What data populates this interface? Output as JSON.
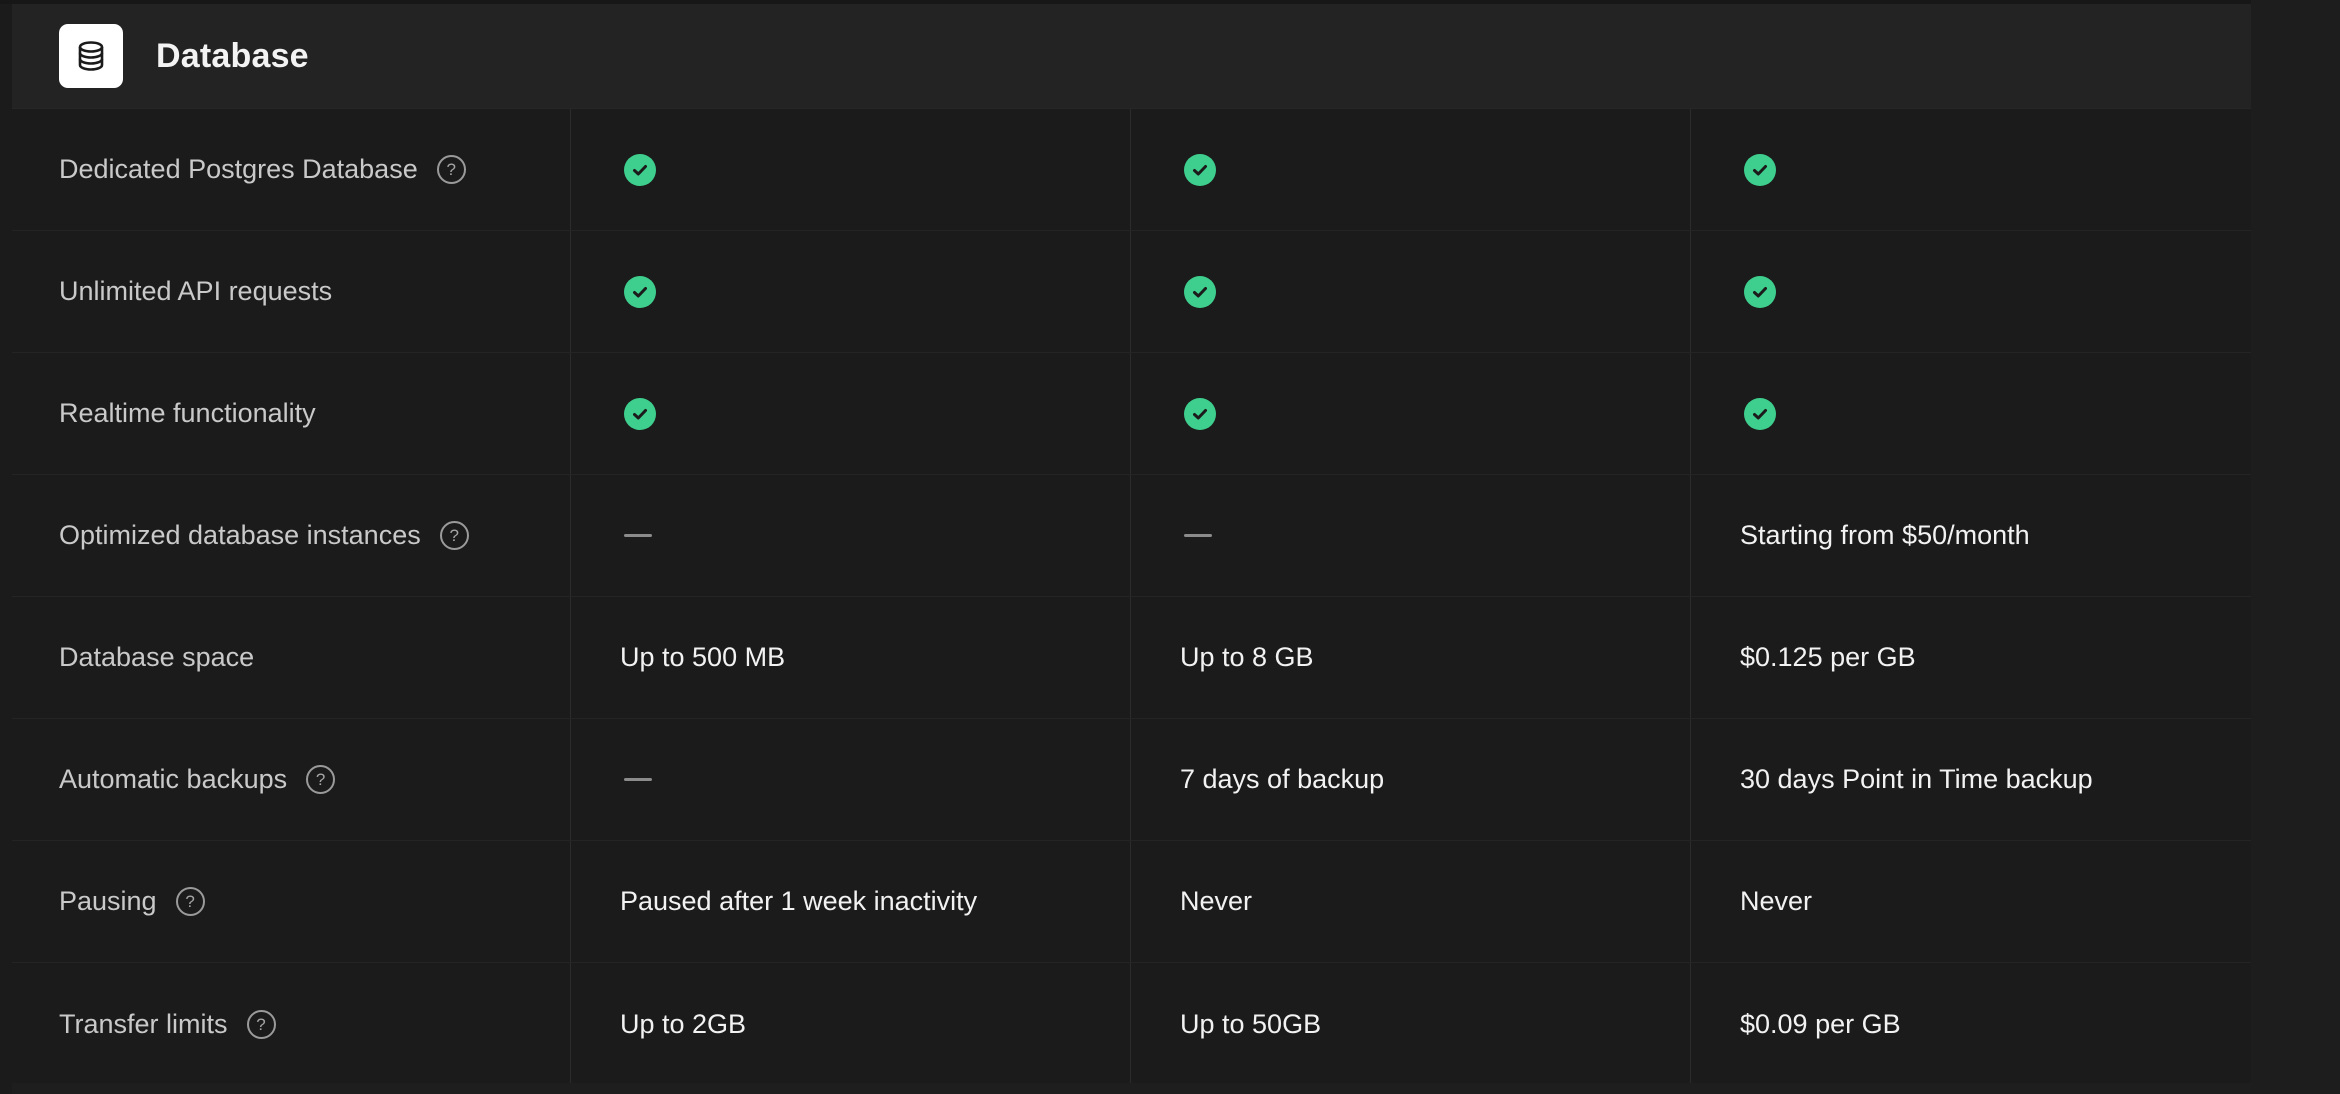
{
  "section": {
    "title": "Database",
    "icon": "database-icon"
  },
  "colors": {
    "check": "#3ecf8e",
    "background": "#1b1b1b",
    "header_background": "#232323"
  },
  "rows": [
    {
      "label": "Dedicated Postgres Database",
      "help": true,
      "cells": [
        {
          "type": "check",
          "icon": "check-circle-icon"
        },
        {
          "type": "check",
          "icon": "check-circle-icon"
        },
        {
          "type": "check",
          "icon": "check-circle-icon"
        }
      ]
    },
    {
      "label": "Unlimited API requests",
      "help": false,
      "cells": [
        {
          "type": "check",
          "icon": "check-circle-icon"
        },
        {
          "type": "check",
          "icon": "check-circle-icon"
        },
        {
          "type": "check",
          "icon": "check-circle-icon"
        }
      ]
    },
    {
      "label": "Realtime functionality",
      "help": false,
      "cells": [
        {
          "type": "check",
          "icon": "check-circle-icon"
        },
        {
          "type": "check",
          "icon": "check-circle-icon"
        },
        {
          "type": "check",
          "icon": "check-circle-icon"
        }
      ]
    },
    {
      "label": "Optimized database instances",
      "help": true,
      "cells": [
        {
          "type": "dash",
          "icon": "dash-icon"
        },
        {
          "type": "dash",
          "icon": "dash-icon"
        },
        {
          "type": "text",
          "text": "Starting from $50/month"
        }
      ]
    },
    {
      "label": "Database space",
      "help": false,
      "cells": [
        {
          "type": "text",
          "text": "Up to 500 MB"
        },
        {
          "type": "text",
          "text": "Up to 8 GB"
        },
        {
          "type": "text",
          "text": "$0.125 per GB"
        }
      ]
    },
    {
      "label": "Automatic backups",
      "help": true,
      "cells": [
        {
          "type": "dash",
          "icon": "dash-icon"
        },
        {
          "type": "text",
          "text": "7 days of backup"
        },
        {
          "type": "text",
          "text": "30 days Point in Time backup"
        }
      ]
    },
    {
      "label": "Pausing",
      "help": true,
      "cells": [
        {
          "type": "text",
          "text": "Paused after 1 week inactivity"
        },
        {
          "type": "text",
          "text": "Never"
        },
        {
          "type": "text",
          "text": "Never"
        }
      ]
    },
    {
      "label": "Transfer limits",
      "help": true,
      "cells": [
        {
          "type": "text",
          "text": "Up to 2GB"
        },
        {
          "type": "text",
          "text": "Up to 50GB"
        },
        {
          "type": "text",
          "text": "$0.09 per GB"
        }
      ]
    }
  ]
}
